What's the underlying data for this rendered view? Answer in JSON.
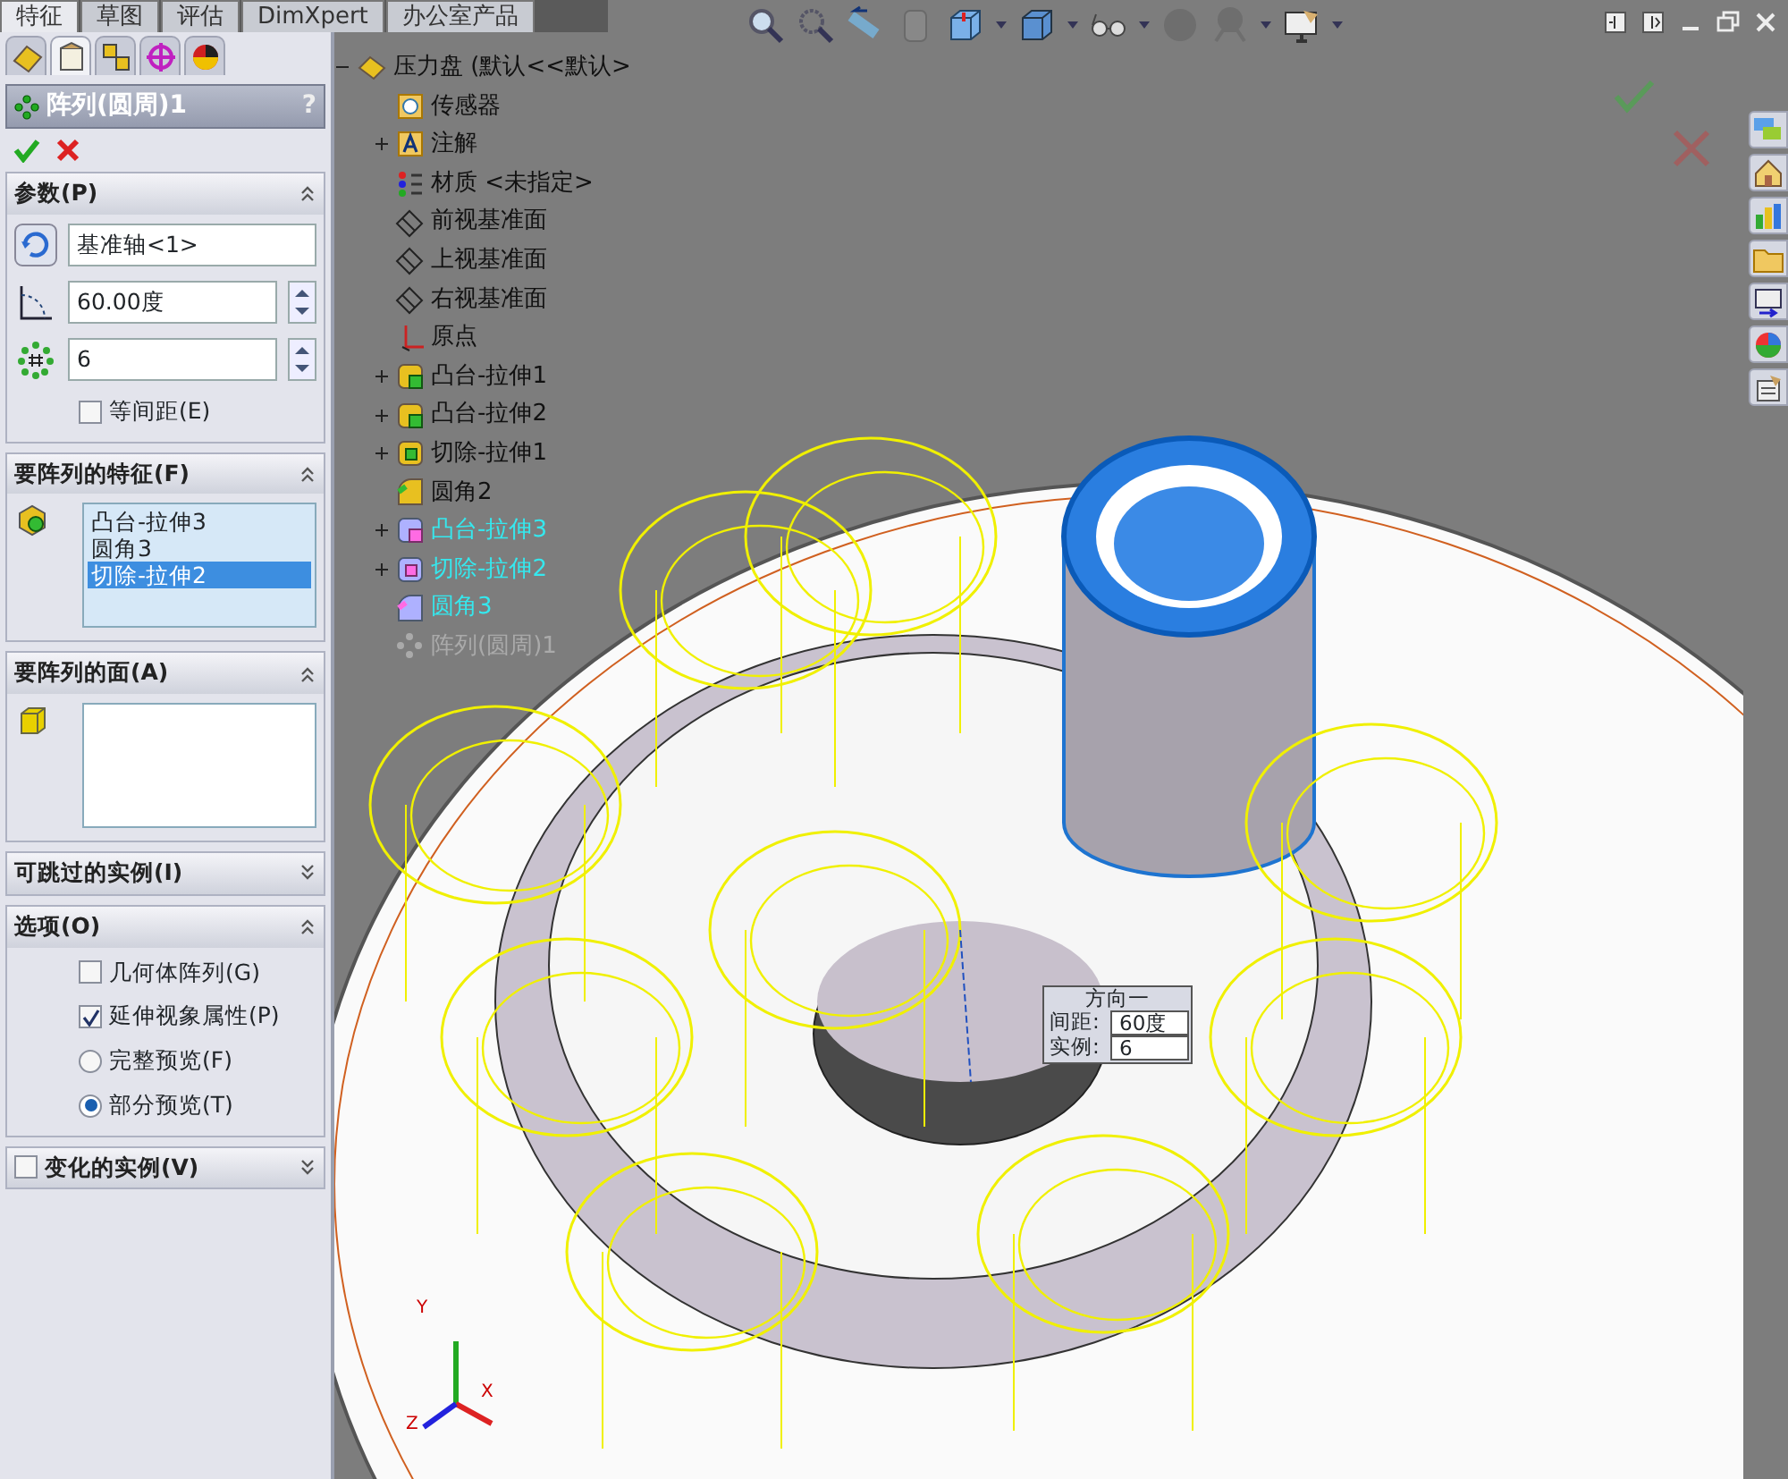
{
  "top_tabs": [
    {
      "label": "特征",
      "selected": true
    },
    {
      "label": "草图",
      "selected": false
    },
    {
      "label": "评估",
      "selected": false
    },
    {
      "label": "DimXpert",
      "selected": false
    },
    {
      "label": "办公室产品",
      "selected": false
    }
  ],
  "panel_tabs": [
    {
      "selected": false
    },
    {
      "selected": true
    },
    {
      "selected": false
    },
    {
      "selected": false
    },
    {
      "selected": false
    }
  ],
  "property_manager": {
    "title": "阵列(圆周)1",
    "help": "?"
  },
  "parameters": {
    "title": "参数(P)",
    "expanded": true,
    "axis_field": {
      "value": "基准轴<1>"
    },
    "angle_field": {
      "value": "60.00度"
    },
    "count_field": {
      "value": "6"
    },
    "equal_spacing": {
      "label": "等间距(E)",
      "checked": false
    }
  },
  "features_to_pattern": {
    "title": "要阵列的特征(F)",
    "expanded": true,
    "items": [
      {
        "label": "凸台-拉伸3",
        "selected": false
      },
      {
        "label": "圆角3",
        "selected": false
      },
      {
        "label": "切除-拉伸2",
        "selected": true
      }
    ]
  },
  "faces_to_pattern": {
    "title": "要阵列的面(A)",
    "expanded": true
  },
  "instances_to_skip": {
    "title": "可跳过的实例(I)",
    "expanded": false
  },
  "options": {
    "title": "选项(O)",
    "expanded": true,
    "items": [
      {
        "kind": "checkbox",
        "label": "几何体阵列(G)",
        "checked": false
      },
      {
        "kind": "checkbox",
        "label": "延伸视象属性(P)",
        "checked": true
      },
      {
        "kind": "radio",
        "label": "完整预览(F)",
        "selected": false
      },
      {
        "kind": "radio",
        "label": "部分预览(T)",
        "selected": true
      }
    ]
  },
  "varied_instances": {
    "title": "变化的实例(V)",
    "expanded": false,
    "checked": false
  },
  "feature_tree": {
    "root": {
      "label": "压力盘 (默认<<默认>",
      "expanded": true
    },
    "items": [
      {
        "kind": "sensor",
        "label": "传感器",
        "expandable": false,
        "selected": false,
        "disabled": false
      },
      {
        "kind": "annotation",
        "label": "注解",
        "expandable": true,
        "selected": false,
        "disabled": false
      },
      {
        "kind": "material",
        "label": "材质 <未指定>",
        "expandable": false,
        "selected": false,
        "disabled": false
      },
      {
        "kind": "plane",
        "label": "前视基准面",
        "expandable": false,
        "selected": false,
        "disabled": false
      },
      {
        "kind": "plane",
        "label": "上视基准面",
        "expandable": false,
        "selected": false,
        "disabled": false
      },
      {
        "kind": "plane",
        "label": "右视基准面",
        "expandable": false,
        "selected": false,
        "disabled": false
      },
      {
        "kind": "origin",
        "label": "原点",
        "expandable": false,
        "selected": false,
        "disabled": false
      },
      {
        "kind": "boss",
        "label": "凸台-拉伸1",
        "expandable": true,
        "selected": false,
        "disabled": false
      },
      {
        "kind": "boss",
        "label": "凸台-拉伸2",
        "expandable": true,
        "selected": false,
        "disabled": false
      },
      {
        "kind": "cut",
        "label": "切除-拉伸1",
        "expandable": true,
        "selected": false,
        "disabled": false
      },
      {
        "kind": "fillet",
        "label": "圆角2",
        "expandable": false,
        "selected": false,
        "disabled": false
      },
      {
        "kind": "boss",
        "label": "凸台-拉伸3",
        "expandable": true,
        "selected": true,
        "disabled": false
      },
      {
        "kind": "cut",
        "label": "切除-拉伸2",
        "expandable": true,
        "selected": true,
        "disabled": false
      },
      {
        "kind": "fillet",
        "label": "圆角3",
        "expandable": false,
        "selected": true,
        "disabled": false
      },
      {
        "kind": "pattern",
        "label": "阵列(圆周)1",
        "expandable": false,
        "selected": false,
        "disabled": true
      }
    ]
  },
  "callout": {
    "title": "方向一",
    "rows": [
      {
        "label": "间距:",
        "value": "60度"
      },
      {
        "label": "实例:",
        "value": "6"
      }
    ]
  },
  "triad": {
    "x": "X",
    "y": "Y",
    "z": "Z"
  }
}
